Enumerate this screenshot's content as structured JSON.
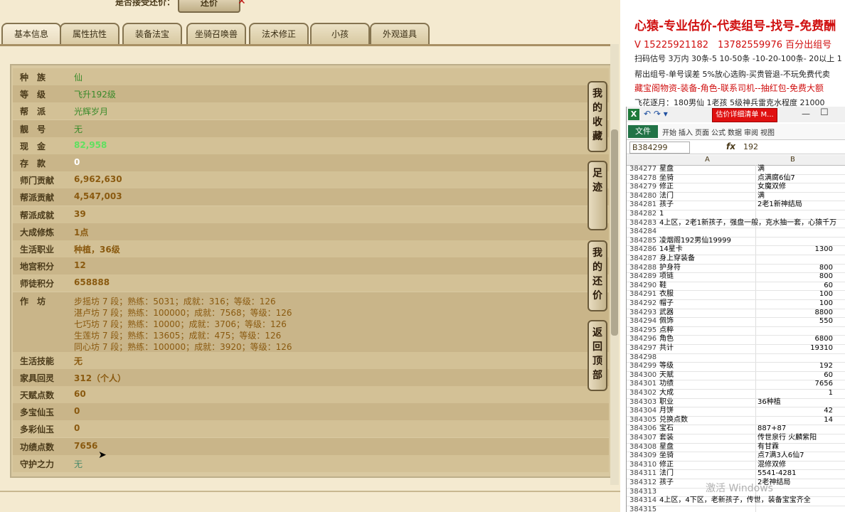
{
  "topbar": {
    "question": "是否接受还价：",
    "counter_button": "还价",
    "mark": "✕"
  },
  "tabs": [
    "基本信息",
    "属性抗性",
    "装备法宝",
    "坐骑召唤兽",
    "法术修正",
    "小孩",
    "外观道具"
  ],
  "rows": [
    {
      "label": "种　族",
      "value": "仙",
      "style": "v-green"
    },
    {
      "label": "等　级",
      "value": "飞升192级",
      "style": "v-green"
    },
    {
      "label": "帮　派",
      "value": "光辉岁月",
      "style": "v-green"
    },
    {
      "label": "靓　号",
      "value": "无",
      "style": "v-green"
    },
    {
      "label": "现　金",
      "value": "82,958",
      "style": "v-bright"
    },
    {
      "label": "存　款",
      "value": "0",
      "style": "v-white"
    },
    {
      "label": "师门贡献",
      "value": "6,962,630",
      "style": "v-brown"
    },
    {
      "label": "帮派贡献",
      "value": "4,547,003",
      "style": "v-brown"
    },
    {
      "label": "帮派成就",
      "value": "39",
      "style": "v-brown"
    },
    {
      "label": "大成修炼",
      "value": "1点",
      "style": "v-brown"
    },
    {
      "label": "生活职业",
      "value": "种植，36级",
      "style": "v-brown"
    },
    {
      "label": "地宫积分",
      "value": "12",
      "style": "v-brown"
    },
    {
      "label": "师徒积分",
      "value": "658888",
      "style": "v-brown"
    }
  ],
  "workshop": {
    "label": "作　坊",
    "lines": [
      "步摇坊 7 段；熟练：5031；成就：316；等级：126",
      "湛卢坊 7 段；熟练：100000；成就：7568；等级：126",
      "七巧坊 7 段；熟练：10000；成就：3706；等级：126",
      "生莲坊 7 段；熟练：13605；成就：475；等级：126",
      "同心坊 7 段；熟练：100000；成就：3920；等级：126"
    ]
  },
  "rows2": [
    {
      "label": "生活技能",
      "value": "无",
      "style": "v-brown"
    },
    {
      "label": "家具回灵",
      "value": "312（个人）",
      "style": "v-brown"
    },
    {
      "label": "天赋点数",
      "value": "60",
      "style": "v-brown"
    },
    {
      "label": "多宝仙玉",
      "value": "0",
      "style": "v-brown"
    },
    {
      "label": "多彩仙玉",
      "value": "0",
      "style": "v-brown"
    },
    {
      "label": "功绩点数",
      "value": "7656",
      "style": "v-brown"
    },
    {
      "label": "守护之力",
      "value": "无",
      "style": "v-teal"
    }
  ],
  "side_buttons": [
    "我的收藏",
    "足迹",
    "我的还价",
    "返回顶部"
  ],
  "ads": {
    "line1": "心猿-专业估价-代卖组号-找号-免费酬",
    "line2": "V 15225921182　13782559976 百分出组号",
    "line3": "扫码估号 3万内 30条-5 10-50条 -10-20-100条- 20以上 1",
    "line4": "帮出组号-单号误差 5%放心选购-买贵管退-不玩免费代卖",
    "line5": "藏宝阁物资-装备-角色-联系司机--抽红包-免费大额",
    "line6": "飞花逐月：180男仙 1老孩 5级神兵雷克水程度 21000"
  },
  "excel": {
    "app_logo": "X",
    "file_tab": "估价详细清单 M...",
    "file_label": "文件",
    "ribbon_tabs": [
      "开始",
      "插入",
      "页面",
      "公式",
      "数据",
      "审阅",
      "视图"
    ],
    "name_box": "B384299",
    "fx": "fx",
    "formula_value": "192",
    "col_a": "A",
    "col_b": "B",
    "rows": [
      {
        "n": "384277",
        "a": "星盘",
        "b": "满",
        "right": false
      },
      {
        "n": "384278",
        "a": "坐骑",
        "b": "点满腐6仙7",
        "right": false
      },
      {
        "n": "384279",
        "a": "修正",
        "b": "女魔双修",
        "right": false
      },
      {
        "n": "384280",
        "a": "法门",
        "b": "满",
        "right": false
      },
      {
        "n": "384281",
        "a": "孩子",
        "b": "2老1新神结局",
        "right": false
      },
      {
        "n": "384282",
        "a": "1",
        "b": "",
        "right": false
      },
      {
        "n": "384283",
        "a": "4上区，2老1新孩子，强盘一般，克水抽一套，心猿千万",
        "b": "",
        "right": false
      },
      {
        "n": "384284",
        "a": "",
        "b": "",
        "right": false
      },
      {
        "n": "384285",
        "a": "凌烟阁192男仙19999",
        "b": "",
        "right": false
      },
      {
        "n": "384286",
        "a": "14星卡",
        "b": "1300",
        "right": true
      },
      {
        "n": "384287",
        "a": "身上穿装备",
        "b": "",
        "right": false
      },
      {
        "n": "384288",
        "a": "护身符",
        "b": "800",
        "right": true
      },
      {
        "n": "384289",
        "a": "项链",
        "b": "800",
        "right": true
      },
      {
        "n": "384290",
        "a": "鞋",
        "b": "60",
        "right": true
      },
      {
        "n": "384291",
        "a": "衣服",
        "b": "100",
        "right": true
      },
      {
        "n": "384292",
        "a": "帽子",
        "b": "100",
        "right": true
      },
      {
        "n": "384293",
        "a": "武器",
        "b": "8800",
        "right": true
      },
      {
        "n": "384294",
        "a": "佩饰",
        "b": "550",
        "right": true
      },
      {
        "n": "384295",
        "a": "点粹",
        "b": "",
        "right": false
      },
      {
        "n": "384296",
        "a": "角色",
        "b": "6800",
        "right": true
      },
      {
        "n": "384297",
        "a": "共计",
        "b": "19310",
        "right": true
      },
      {
        "n": "384298",
        "a": "",
        "b": "",
        "right": false
      },
      {
        "n": "384299",
        "a": "等级",
        "b": "192",
        "right": true
      },
      {
        "n": "384300",
        "a": "天赋",
        "b": "60",
        "right": true
      },
      {
        "n": "384301",
        "a": "功绩",
        "b": "7656",
        "right": true
      },
      {
        "n": "384302",
        "a": "大成",
        "b": "1",
        "right": true
      },
      {
        "n": "384303",
        "a": "职业",
        "b": "36种植",
        "right": false
      },
      {
        "n": "384304",
        "a": "月饼",
        "b": "42",
        "right": true
      },
      {
        "n": "384305",
        "a": "兑换点数",
        "b": "14",
        "right": true
      },
      {
        "n": "384306",
        "a": "宝石",
        "b": "887+87",
        "right": false
      },
      {
        "n": "384307",
        "a": "套装",
        "b": "传世泉行 火麟紫阳",
        "right": false
      },
      {
        "n": "384308",
        "a": "星盘",
        "b": "有甘霖",
        "right": false
      },
      {
        "n": "384309",
        "a": "坐骑",
        "b": "点7满3人6仙7",
        "right": false
      },
      {
        "n": "384310",
        "a": "修正",
        "b": "混修双修",
        "right": false
      },
      {
        "n": "384311",
        "a": "法门",
        "b": "5541-4281",
        "right": false
      },
      {
        "n": "384312",
        "a": "孩子",
        "b": "2老神结局",
        "right": false
      },
      {
        "n": "384313",
        "a": "",
        "b": "",
        "right": false
      },
      {
        "n": "384314",
        "a": "4上区，4下区，老新孩子，传世，装备宝宝齐全",
        "b": "",
        "right": false
      },
      {
        "n": "384315",
        "a": "",
        "b": "",
        "right": false
      }
    ],
    "watermark": "激活 Windows"
  }
}
